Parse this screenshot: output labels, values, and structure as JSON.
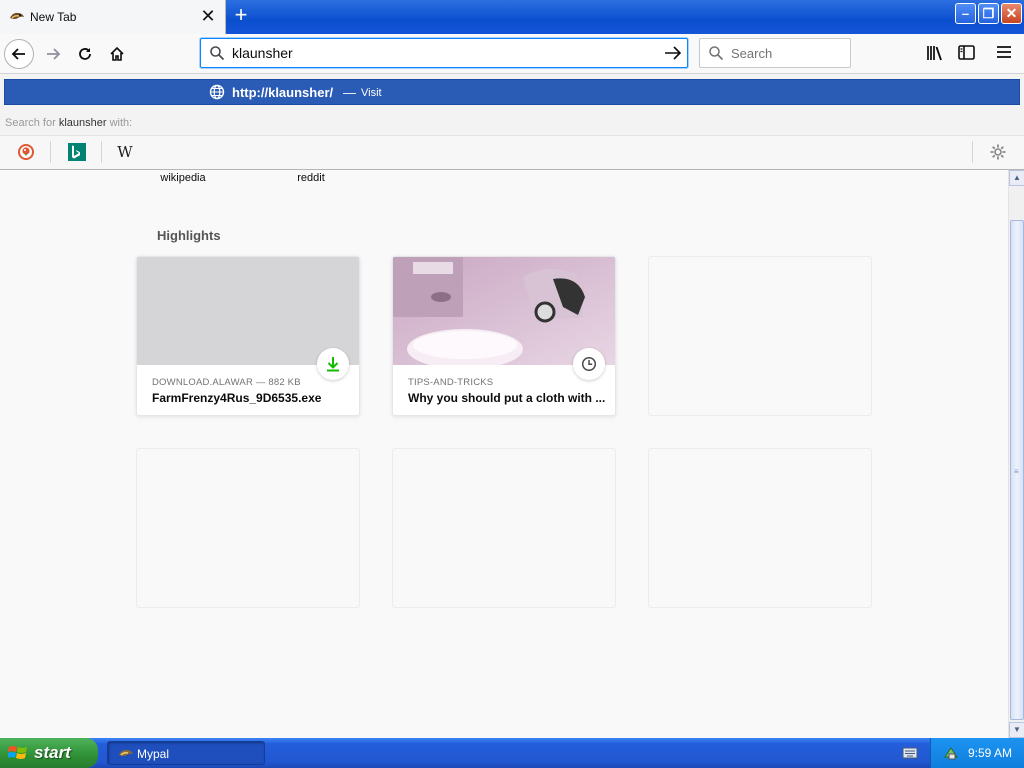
{
  "tab": {
    "title": "New Tab",
    "close_symbol": "✕",
    "newtab_symbol": "+"
  },
  "window": {
    "min_symbol": "–",
    "max_symbol": "❐",
    "close_symbol": "✕"
  },
  "urlbar": {
    "value": "klaunsher"
  },
  "searchbar": {
    "placeholder": "Search"
  },
  "suggestion": {
    "url_prefix": "http://",
    "url_host": "klaunsher",
    "url_suffix": "/",
    "dash": "—",
    "action": "Visit"
  },
  "search_for": {
    "prefix": "Search for ",
    "query": "klaunsher",
    "suffix": " with:"
  },
  "engines": {
    "wikipedia_symbol": "W"
  },
  "top_sites": [
    "wikipedia",
    "reddit"
  ],
  "highlights": {
    "title": "Highlights",
    "cards": [
      {
        "meta": "DOWNLOAD.ALAWAR — 882 KB",
        "title": "FarmFrenzy4Rus_9D6535.exe",
        "badge": "download-icon"
      },
      {
        "meta": "TIPS-AND-TRICKS",
        "title": "Why you should put a cloth with ...",
        "badge": "clock-icon"
      }
    ]
  },
  "scrollbar": {
    "up": "▲",
    "down": "▼",
    "grip": "≡"
  },
  "taskbar": {
    "start_label": "start",
    "task_label": "Mypal",
    "clock": "9:59 AM"
  },
  "colors": {
    "suggest_bg": "#2a5bb5",
    "download_green": "#12bc00",
    "taskbar_blue": "#245edb",
    "start_green": "#2e8f35"
  }
}
